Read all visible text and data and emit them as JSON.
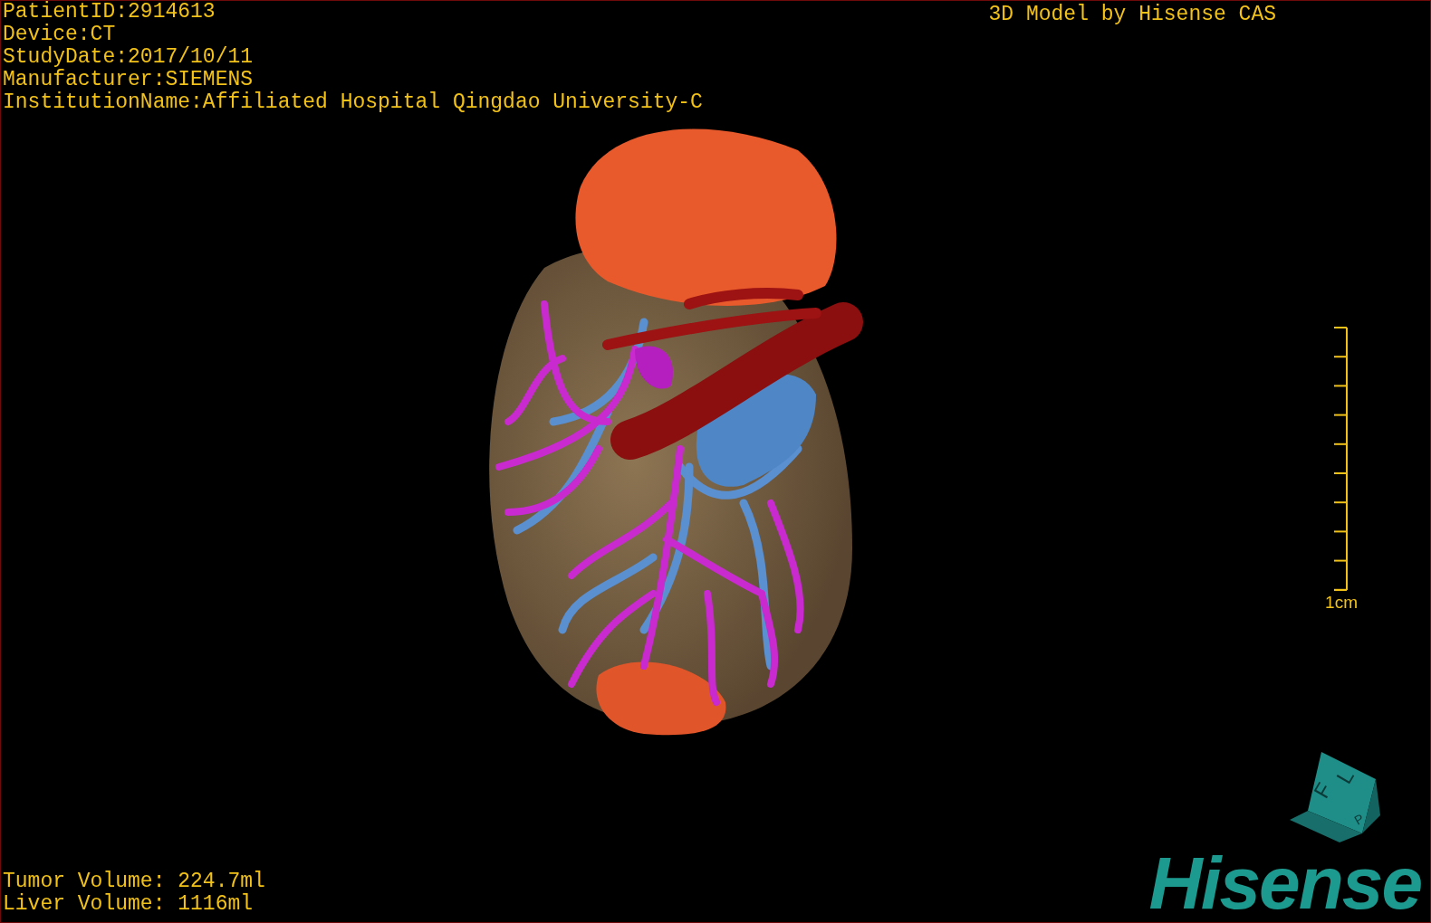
{
  "patient_info": [
    "PatientID:2914613",
    "Device:CT",
    "StudyDate:2017/10/11",
    "Manufacturer:SIEMENS",
    "InstitutionName:Affiliated Hospital Qingdao University-C"
  ],
  "title": "3D Model by Hisense CAS",
  "scale_bar": {
    "label": "1cm"
  },
  "volumes": [
    "Tumor Volume: 224.7ml",
    "Liver Volume: 1116ml"
  ],
  "orientation_cube": {
    "faces": [
      "F",
      "L",
      "P"
    ]
  },
  "logo": "Hisense"
}
